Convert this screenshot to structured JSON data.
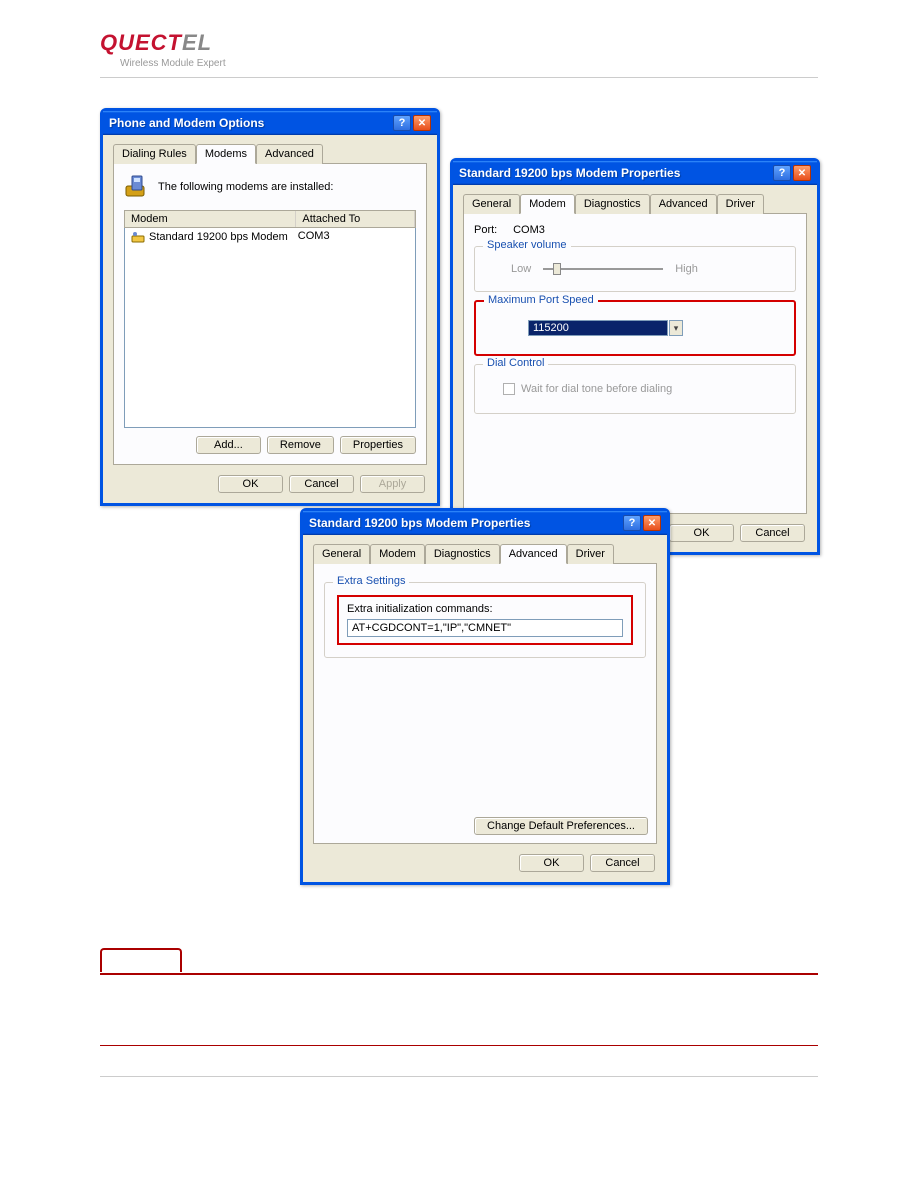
{
  "header": {
    "logo_main": "QUECT",
    "logo_tail": "EL",
    "tagline": "Wireless Module Expert"
  },
  "dialog1": {
    "title": "Phone and Modem Options",
    "tabs": [
      "Dialing Rules",
      "Modems",
      "Advanced"
    ],
    "active_tab": 1,
    "desc": "The following modems are installed:",
    "columns": {
      "modem": "Modem",
      "attached": "Attached To"
    },
    "row": {
      "name": "Standard 19200 bps Modem",
      "port": "COM3"
    },
    "buttons": {
      "add": "Add...",
      "remove": "Remove",
      "properties": "Properties"
    },
    "footer": {
      "ok": "OK",
      "cancel": "Cancel",
      "apply": "Apply"
    }
  },
  "dialog2": {
    "title": "Standard 19200 bps Modem Properties",
    "tabs": [
      "General",
      "Modem",
      "Diagnostics",
      "Advanced",
      "Driver"
    ],
    "active_tab": 1,
    "port_label": "Port:",
    "port_value": "COM3",
    "group_speaker": "Speaker volume",
    "low": "Low",
    "high": "High",
    "group_speed": "Maximum Port Speed",
    "speed_value": "115200",
    "group_dial": "Dial Control",
    "dial_check": "Wait for dial tone before dialing",
    "footer": {
      "ok": "OK",
      "cancel": "Cancel"
    }
  },
  "dialog3": {
    "title": "Standard 19200 bps Modem Properties",
    "tabs": [
      "General",
      "Modem",
      "Diagnostics",
      "Advanced",
      "Driver"
    ],
    "active_tab": 3,
    "group_extra": "Extra Settings",
    "extra_label": "Extra initialization commands:",
    "extra_value": "AT+CGDCONT=1,\"IP\",\"CMNET\"",
    "change_btn": "Change Default Preferences...",
    "footer": {
      "ok": "OK",
      "cancel": "Cancel"
    }
  }
}
